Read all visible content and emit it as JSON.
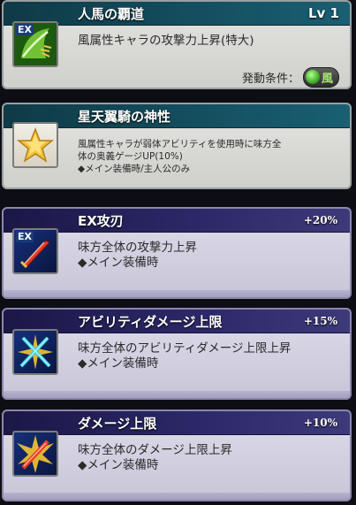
{
  "skills": [
    {
      "title": "人馬の覇道",
      "level": "Lv 1",
      "desc": "風属性キャラの攻撃力上昇(特大)",
      "condition_label": "発動条件：",
      "condition_value": "風",
      "icon": "wind-bow-icon",
      "icon_badge": "EX"
    },
    {
      "title": "星天翼騎の神性",
      "desc_line1": "風属性キャラが弱体アビリティを使用時に味方全",
      "desc_line2": "体の奥義ゲージUP(10%)",
      "desc_line3": "◆メイン装備時/主人公のみ",
      "icon": "star-icon"
    },
    {
      "title": "EX攻刃",
      "bonus": "+20%",
      "desc_line1": "味方全体の攻撃力上昇",
      "desc_line2": "◆メイン装備時",
      "icon": "red-sword-icon",
      "icon_badge": "EX"
    },
    {
      "title": "アビリティダメージ上限",
      "bonus": "+15%",
      "desc_line1": "味方全体のアビリティダメージ上限上昇",
      "desc_line2": "◆メイン装備時",
      "icon": "crossed-swords-icon"
    },
    {
      "title": "ダメージ上限",
      "bonus": "+10%",
      "desc_line1": "味方全体のダメージ上限上昇",
      "desc_line2": "◆メイン装備時",
      "icon": "burst-sword-icon"
    }
  ],
  "colors": {
    "teal_header": "#145062",
    "purple_header": "#2c2868",
    "wind_green": "#a9e86a"
  }
}
